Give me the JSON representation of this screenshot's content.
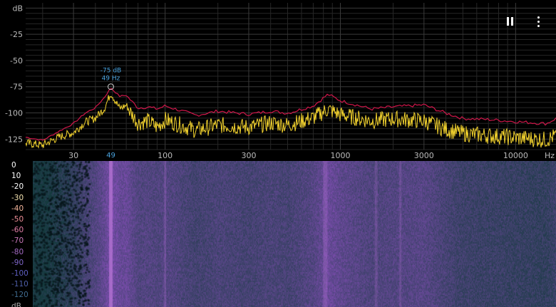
{
  "spectrum": {
    "y_ticks": [
      {
        "label": "dB",
        "db": 0
      },
      {
        "label": "-25",
        "db": -25
      },
      {
        "label": "-50",
        "db": -50
      },
      {
        "label": "-75",
        "db": -75
      },
      {
        "label": "-100",
        "db": -100
      },
      {
        "label": "-125",
        "db": -125
      }
    ],
    "x_ticks": [
      {
        "label": "30",
        "hz": 30
      },
      {
        "label": "100",
        "hz": 100
      },
      {
        "label": "300",
        "hz": 300
      },
      {
        "label": "1000",
        "hz": 1000
      },
      {
        "label": "3000",
        "hz": 3000
      },
      {
        "label": "10000",
        "hz": 10000
      }
    ],
    "x_unit": "Hz",
    "db_range": [
      -135,
      5
    ],
    "hz_range": [
      16,
      17000
    ],
    "peak": {
      "db_label": "-75 dB",
      "hz_label": "49 Hz",
      "axis_label": "49",
      "hz": 49,
      "db": -75
    },
    "colors": {
      "peak_hold": "#d0164a",
      "live": "#f2d22e",
      "grid": "#3a3a3a",
      "peak_marker": "#4aa3df"
    }
  },
  "chart_data": {
    "type": "line",
    "xlabel": "Hz",
    "ylabel": "dB",
    "xscale": "log",
    "xlim": [
      16,
      17000
    ],
    "ylim": [
      -135,
      5
    ],
    "series": [
      {
        "hz": [
          16,
          20,
          25,
          30,
          35,
          40,
          45,
          49,
          55,
          60,
          70,
          80,
          90,
          100,
          150,
          200,
          300,
          400,
          500,
          700,
          850,
          1000,
          1500,
          2000,
          3000,
          4000,
          5000,
          7000,
          10000,
          15000,
          17000
        ],
        "db": [
          -123,
          -126,
          -117,
          -110,
          -100,
          -95,
          -85,
          -76,
          -84,
          -83,
          -95,
          -94,
          -96,
          -93,
          -102,
          -98,
          -101,
          -98,
          -100,
          -93,
          -82,
          -88,
          -96,
          -94,
          -92,
          -100,
          -105,
          -106,
          -108,
          -110,
          -105
        ]
      },
      {
        "hz": [
          16,
          20,
          25,
          30,
          35,
          40,
          45,
          49,
          55,
          60,
          70,
          80,
          90,
          100,
          150,
          200,
          300,
          400,
          500,
          700,
          850,
          1000,
          1500,
          2000,
          3000,
          4000,
          5000,
          7000,
          10000,
          15000,
          17000
        ],
        "db": [
          -128,
          -130,
          -122,
          -118,
          -108,
          -104,
          -95,
          -80,
          -95,
          -92,
          -108,
          -106,
          -112,
          -105,
          -115,
          -110,
          -112,
          -108,
          -110,
          -103,
          -95,
          -100,
          -106,
          -104,
          -106,
          -114,
          -118,
          -120,
          -122,
          -124,
          -120
        ]
      }
    ]
  },
  "spectrogram": {
    "scale_labels": [
      {
        "text": "0",
        "color": "#ffffff"
      },
      {
        "text": "10",
        "color": "#ffffff"
      },
      {
        "text": "-20",
        "color": "#ffffff"
      },
      {
        "text": "-30",
        "color": "#f4e3b0"
      },
      {
        "text": "-40",
        "color": "#f2b49a"
      },
      {
        "text": "-50",
        "color": "#ee8d96"
      },
      {
        "text": "-60",
        "color": "#e47ea8"
      },
      {
        "text": "-70",
        "color": "#c877b8"
      },
      {
        "text": "-80",
        "color": "#a46ac4"
      },
      {
        "text": "-90",
        "color": "#7e65c8"
      },
      {
        "text": "-100",
        "color": "#5f5fc2"
      },
      {
        "text": "-110",
        "color": "#4e5ea8"
      },
      {
        "text": "-120",
        "color": "#3f6a8e"
      },
      {
        "text": "dB",
        "color": "#aaaaaa"
      }
    ],
    "colors": {
      "background": "#153a3e",
      "mid": "#3a4f8f",
      "hot": "#b070d0"
    }
  }
}
